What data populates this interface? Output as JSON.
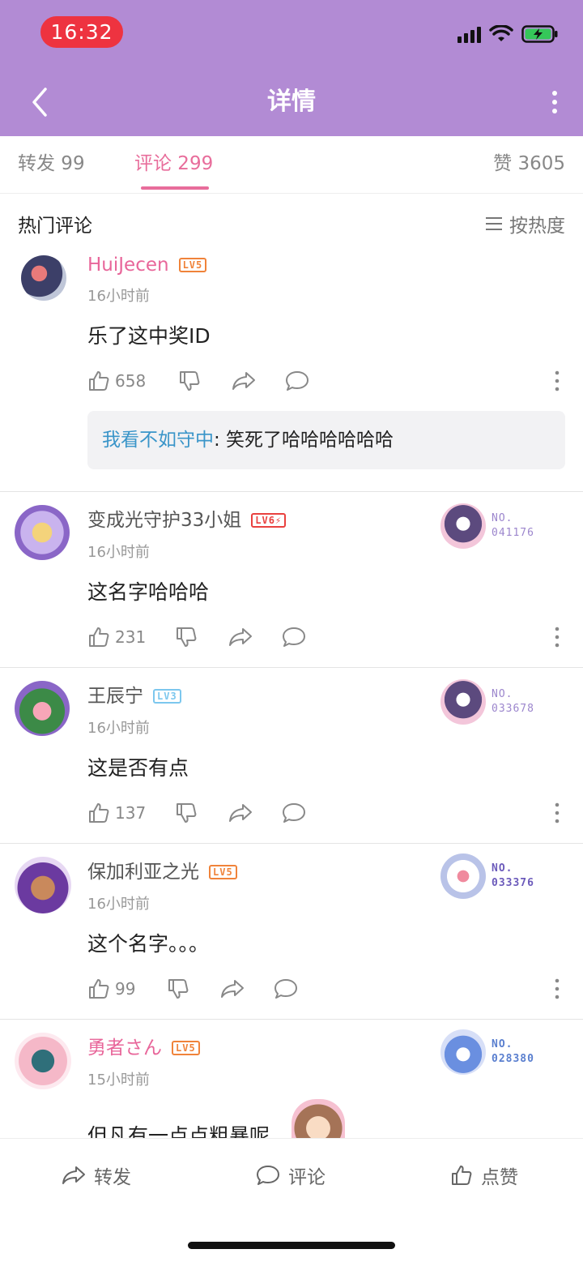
{
  "status": {
    "time": "16:32"
  },
  "nav": {
    "title": "详情"
  },
  "tabs": {
    "forward": "转发 99",
    "comments": "评论 299",
    "likes": "赞 3605"
  },
  "section": {
    "title": "热门评论",
    "sort": "按热度"
  },
  "comments": [
    {
      "user": "HuiJecen",
      "level": "LV5",
      "time": "16小时前",
      "text": "乐了这中奖ID",
      "likes": "658",
      "reply": {
        "user": "我看不如守中",
        "text": ": 笑死了哈哈哈哈哈哈"
      }
    },
    {
      "user": "变成光守护33小姐",
      "level": "LV6⚡",
      "time": "16小时前",
      "text": "这名字哈哈哈",
      "likes": "231",
      "badge_no": "NO.",
      "badge_num": "041176"
    },
    {
      "user": "王辰宁",
      "level": "LV3",
      "time": "16小时前",
      "text": "这是否有点",
      "likes": "137",
      "badge_no": "NO.",
      "badge_num": "033678"
    },
    {
      "user": "保加利亚之光",
      "level": "LV5",
      "time": "16小时前",
      "text": "这个名字。。。",
      "likes": "99",
      "badge_no": "NO.",
      "badge_num": "033376"
    },
    {
      "user": "勇者さん",
      "level": "LV5",
      "time": "15小时前",
      "text": "但凡有一点点粗暴呢",
      "badge_no": "NO.",
      "badge_num": "028380"
    }
  ],
  "bottom": {
    "forward": "转发",
    "comment": "评论",
    "like": "点赞"
  },
  "colors": {
    "header": "#b28bd4",
    "accent": "#e86d9b",
    "reply_user": "#3a95c9"
  }
}
